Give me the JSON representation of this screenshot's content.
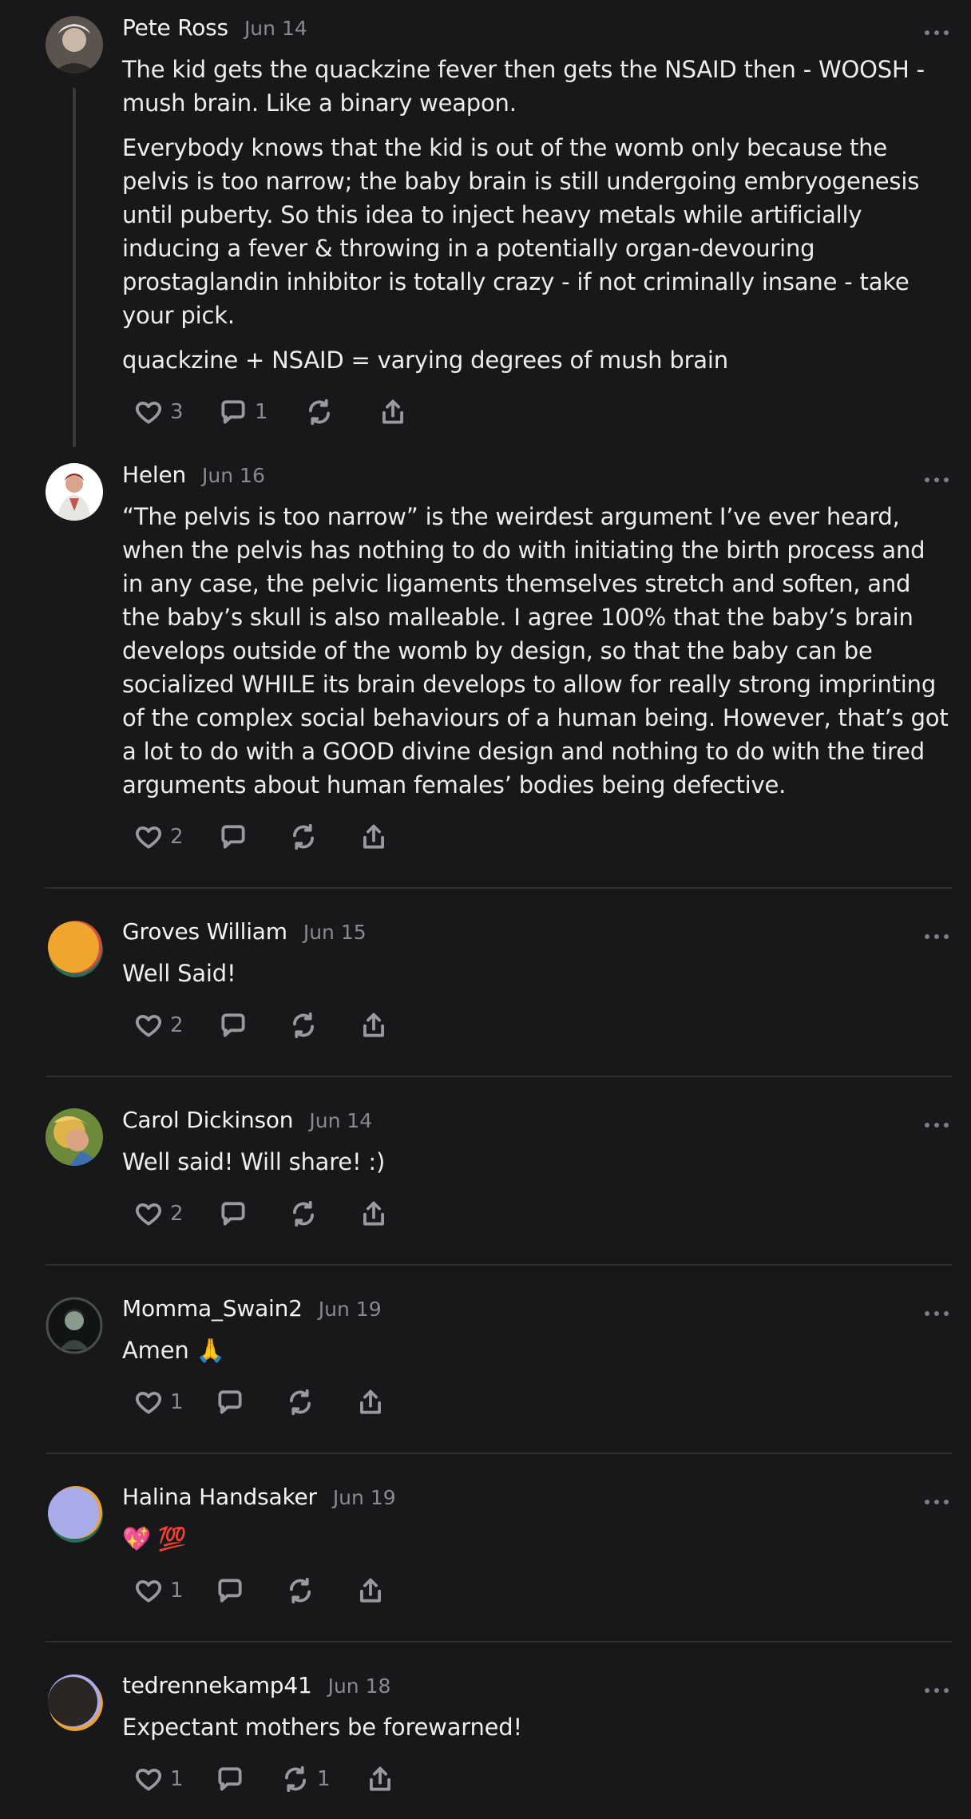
{
  "comments": [
    {
      "author": "Pete Ross",
      "date": "Jun 14",
      "paragraphs": [
        "The kid gets the quackzine fever then gets the NSAID then - WOOSH - mush brain. Like a binary weapon.",
        "Everybody knows that the kid is out of the womb only because the pelvis is too narrow; the baby brain is still undergoing embryogenesis until puberty. So this idea to inject heavy metals while artificially inducing a fever & throwing in a potentially organ-devouring prostaglandin inhibitor is totally crazy - if not criminally insane - take your pick.",
        "quackzine + NSAID = varying degrees of mush brain"
      ],
      "likes": "3",
      "replies": "1",
      "restacks": ""
    },
    {
      "author": "Helen",
      "date": "Jun 16",
      "paragraphs": [
        "“The pelvis is too narrow” is the weirdest argument I’ve ever heard, when the pelvis has nothing to do with initiating the birth process and in any case, the pelvic ligaments themselves stretch and soften, and the baby’s skull is also malleable. I agree 100% that the baby’s brain develops outside of the womb by design, so that the baby can be socialized WHILE its brain develops to allow for really strong imprinting of the complex social behaviours of a human being. However, that’s got a lot to do with a GOOD divine design and nothing to do with the tired arguments about human females’ bodies being defective."
      ],
      "likes": "2",
      "replies": "",
      "restacks": ""
    },
    {
      "author": "Groves William",
      "date": "Jun 15",
      "paragraphs": [
        "Well Said!"
      ],
      "likes": "2",
      "replies": "",
      "restacks": ""
    },
    {
      "author": "Carol Dickinson",
      "date": "Jun 14",
      "paragraphs": [
        "Well said! Will share! :)"
      ],
      "likes": "2",
      "replies": "",
      "restacks": ""
    },
    {
      "author": "Momma_Swain2",
      "date": "Jun 19",
      "paragraphs": [
        "Amen 🙏"
      ],
      "likes": "1",
      "replies": "",
      "restacks": ""
    },
    {
      "author": "Halina Handsaker",
      "date": "Jun 19",
      "paragraphs": [
        "💖 💯"
      ],
      "likes": "1",
      "replies": "",
      "restacks": ""
    },
    {
      "author": "tedrennekamp41",
      "date": "Jun 18",
      "paragraphs": [
        "Expectant mothers be forewarned!"
      ],
      "likes": "1",
      "replies": "",
      "restacks": "1"
    }
  ],
  "icons": {
    "like": "heart-icon",
    "reply": "comment-bubble-icon",
    "restack": "restack-icon",
    "share": "share-icon",
    "more": "more-dots-icon"
  }
}
